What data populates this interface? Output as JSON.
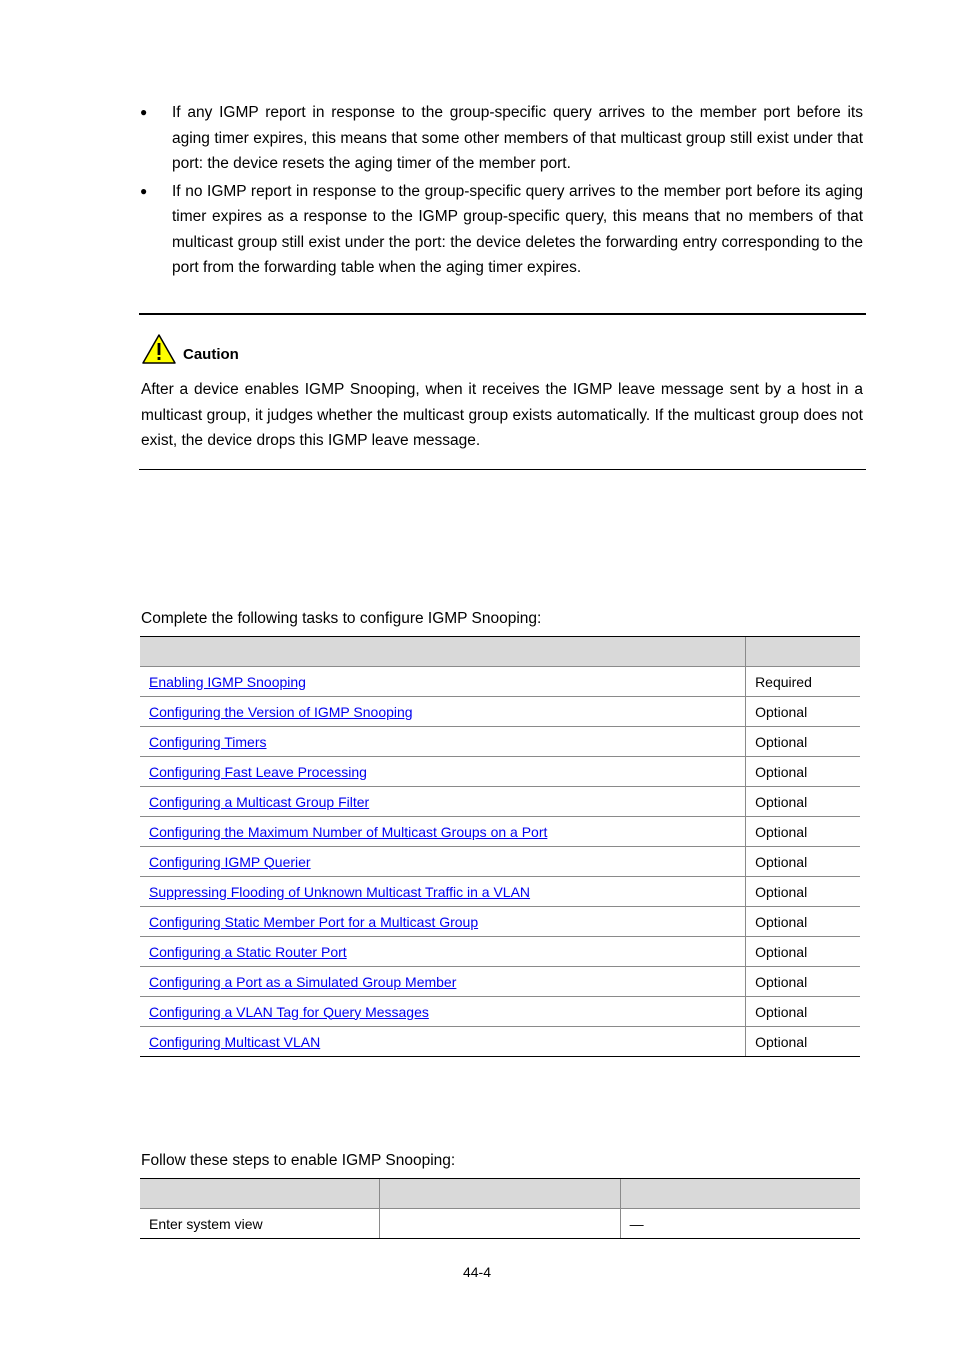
{
  "bullets": [
    "If any IGMP report in response to the group-specific query arrives to the member port before its aging timer expires, this means that some other members of that multicast group still exist under that port: the device resets the aging timer of the member port.",
    "If no IGMP report in response to the group-specific query arrives to the member port before its aging timer expires as a response to the IGMP group-specific query, this means that no members of that multicast group still exist under the port: the device deletes the forwarding entry corresponding to the port from the forwarding table when the aging timer expires."
  ],
  "caution": {
    "icon": "warning-triangle-icon",
    "label": "Caution",
    "text": "After a device enables IGMP Snooping, when it receives the IGMP leave message sent by a host in a multicast group, it judges whether the multicast group exists automatically. If the multicast group does not exist, the device drops this IGMP leave message."
  },
  "tasks": {
    "intro": "Complete the following tasks to configure IGMP Snooping:",
    "headers": [
      "",
      ""
    ],
    "rows": [
      {
        "task": "Enabling IGMP Snooping",
        "remark": "Required"
      },
      {
        "task": "Configuring the Version of IGMP Snooping",
        "remark": "Optional"
      },
      {
        "task": "Configuring Timers",
        "remark": "Optional"
      },
      {
        "task": "Configuring Fast Leave Processing",
        "remark": "Optional"
      },
      {
        "task": "Configuring a Multicast Group Filter",
        "remark": "Optional"
      },
      {
        "task": "Configuring the Maximum Number of Multicast Groups on a Port",
        "remark": "Optional"
      },
      {
        "task": "Configuring IGMP Querier",
        "remark": "Optional"
      },
      {
        "task": "Suppressing Flooding of Unknown Multicast Traffic in a VLAN",
        "remark": "Optional"
      },
      {
        "task": "Configuring Static Member Port for a Multicast Group",
        "remark": "Optional"
      },
      {
        "task": "Configuring a Static Router Port",
        "remark": "Optional"
      },
      {
        "task": "Configuring a Port as a Simulated Group Member",
        "remark": "Optional"
      },
      {
        "task": "Configuring a VLAN Tag for Query Messages",
        "remark": "Optional"
      },
      {
        "task": "Configuring Multicast VLAN",
        "remark": "Optional"
      }
    ]
  },
  "steps": {
    "intro": "Follow these steps to enable IGMP Snooping:",
    "headers": [
      "",
      "",
      ""
    ],
    "rows": [
      {
        "operation": "Enter system view",
        "command": "",
        "remarks": "—"
      }
    ]
  },
  "page_number": "44-4"
}
